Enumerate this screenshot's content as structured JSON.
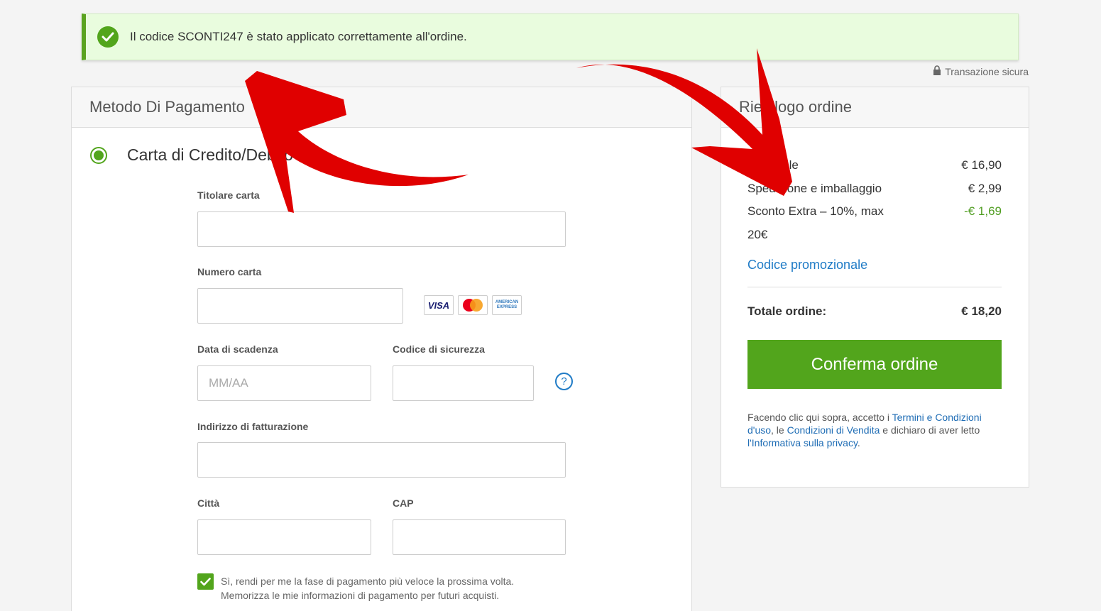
{
  "alert": {
    "message": "Il codice SCONTI247 è stato applicato correttamente all'ordine.",
    "icon": "check-circle-icon"
  },
  "secure": {
    "label": "Transazione sicura",
    "icon": "lock-icon"
  },
  "payment": {
    "title": "Metodo Di Pagamento",
    "method": "Carta di Credito/Debito",
    "fields": {
      "holder_label": "Titolare carta",
      "number_label": "Numero carta",
      "expiry_label": "Data di scadenza",
      "expiry_placeholder": "MM/AA",
      "cvv_label": "Codice di sicurezza",
      "address_label": "Indirizzo di fatturazione",
      "city_label": "Città",
      "zip_label": "CAP"
    },
    "cards": {
      "visa": "VISA",
      "amex_line1": "AMERICAN",
      "amex_line2": "EXPRESS"
    },
    "help_glyph": "?",
    "remember_line1": "Sì, rendi per me la fase di pagamento più veloce la prossima volta.",
    "remember_line2": "Memorizza le mie informazioni di pagamento per futuri acquisti.",
    "remember_checked": true
  },
  "summary": {
    "title": "Riepilogo ordine",
    "rows": [
      {
        "label": "Subtotale",
        "value": "€ 16,90"
      },
      {
        "label": "Spedizione e imballaggio",
        "value": "€ 2,99"
      },
      {
        "label": "Sconto Extra – 10%, max",
        "label2": "20€",
        "value": "-€ 1,69"
      }
    ],
    "promo_link": "Codice promozionale",
    "total_label": "Totale ordine:",
    "total_value": "€ 18,20",
    "confirm_label": "Conferma ordine",
    "legal": {
      "t1": "Facendo clic qui sopra, accetto i ",
      "l1": "Termini e Condizioni d'uso",
      "t2": ", le ",
      "l2": "Condizioni di Vendita",
      "t3": " e dichiaro di aver letto ",
      "l3": "l'Informativa sulla privacy",
      "t4": "."
    }
  },
  "colors": {
    "accent_green": "#52a51c",
    "link_blue": "#1f7bc6",
    "arrow_red": "#e00000"
  }
}
